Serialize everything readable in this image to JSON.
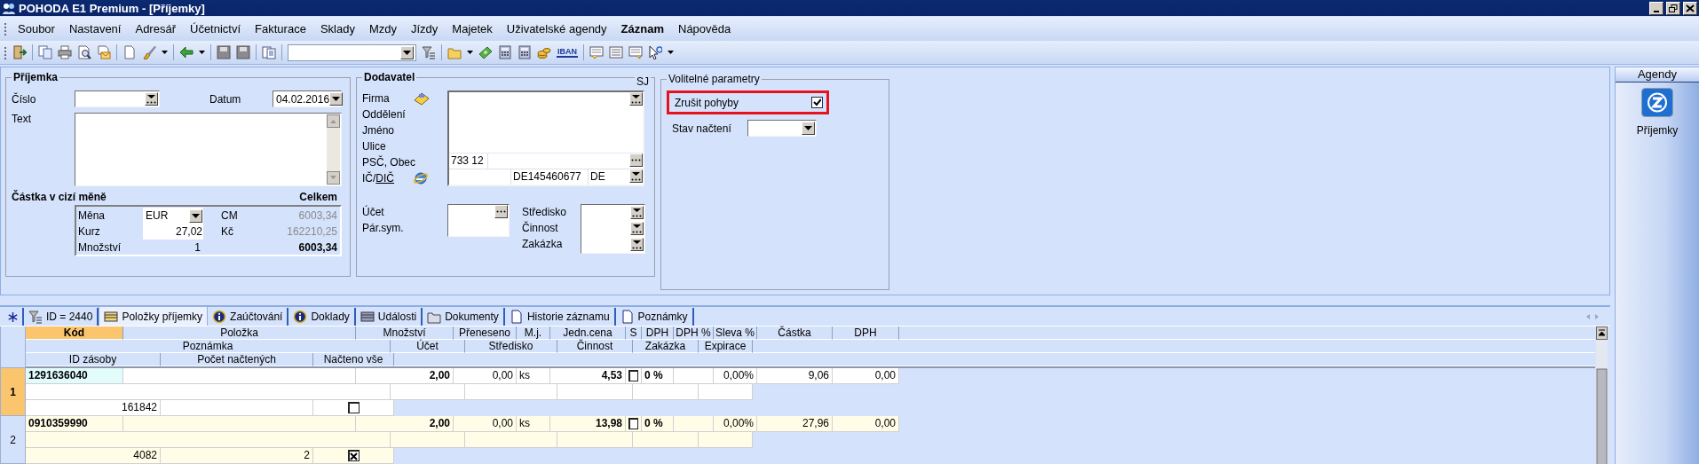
{
  "window": {
    "title": "POHODA E1 Premium - [Příjemky]"
  },
  "menu": [
    {
      "label": "Soubor",
      "bold": false
    },
    {
      "label": "Nastavení",
      "bold": false
    },
    {
      "label": "Adresář",
      "bold": false
    },
    {
      "label": "Účetnictví",
      "bold": false
    },
    {
      "label": "Fakturace",
      "bold": false
    },
    {
      "label": "Sklady",
      "bold": false
    },
    {
      "label": "Mzdy",
      "bold": false
    },
    {
      "label": "Jízdy",
      "bold": false
    },
    {
      "label": "Majetek",
      "bold": false
    },
    {
      "label": "Uživatelské agendy",
      "bold": false
    },
    {
      "label": "Záznam",
      "bold": true
    },
    {
      "label": "Nápověda",
      "bold": false
    }
  ],
  "toolbar": {
    "iban_label": "IBAN"
  },
  "receipt": {
    "title": "Příjemka",
    "number_label": "Číslo",
    "date_label": "Datum",
    "date_value": "04.02.2016",
    "text_label": "Text",
    "foreign": {
      "title": "Částka v cizí měně",
      "total_heading": "Celkem",
      "lines": [
        {
          "label": "Měna",
          "value": "EUR",
          "kind": "dropdown",
          "total_label": "CM",
          "total": "6003,34",
          "total_dimmed": true,
          "total_bold": false
        },
        {
          "label": "Kurz",
          "value": "27,02",
          "kind": "input",
          "total_label": "Kč",
          "total": "162210,25",
          "total_dimmed": true,
          "total_bold": false
        },
        {
          "label": "Množství",
          "value": "1",
          "kind": "plain",
          "total": "6003,34",
          "total_dimmed": false,
          "total_bold": true
        }
      ]
    }
  },
  "supplier": {
    "title": "Dodavatel",
    "corner": "SJ",
    "labels": [
      "Firma",
      "Oddělení",
      "Jméno",
      "Ulice",
      "PSČ, Obec"
    ],
    "ic_label": "IČ/",
    "dic_link": "DIČ",
    "psc": "733 12",
    "dic": "DE145460677",
    "country": "DE",
    "account_label": "Účet",
    "symbol_label": "Pár.sym.",
    "centre_labels": [
      "Středisko",
      "Činnost",
      "Zakázka"
    ]
  },
  "options": {
    "title": "Volitelné parametry",
    "cancel_moves": {
      "label": "Zrušit pohyby",
      "checked": true,
      "highlighted": true
    },
    "load_state": {
      "label": "Stav načtení"
    }
  },
  "agenda": {
    "title": "Agendy",
    "items": [
      {
        "label": "Příjemky"
      }
    ]
  },
  "tabs": [
    {
      "label": "ID = 2440",
      "kind": "filter",
      "selected": false
    },
    {
      "label": "Položky příjemky",
      "kind": "list",
      "selected": true
    },
    {
      "label": "Zaúčtování",
      "kind": "info",
      "selected": false
    },
    {
      "label": "Doklady",
      "kind": "info",
      "selected": false
    },
    {
      "label": "Události",
      "kind": "table",
      "selected": false
    },
    {
      "label": "Dokumenty",
      "kind": "folder",
      "selected": false
    },
    {
      "label": "Historie záznamu",
      "kind": "page",
      "selected": false
    },
    {
      "label": "Poznámky",
      "kind": "page",
      "selected": false
    }
  ],
  "grid": {
    "columns_line1": [
      {
        "label": "Kód",
        "selected": true
      },
      {
        "label": "Položka",
        "selected": false
      },
      {
        "label": "Množství",
        "selected": false
      },
      {
        "label": "Přeneseno",
        "selected": false
      },
      {
        "label": "M.j.",
        "selected": false
      },
      {
        "label": "Jedn.cena",
        "selected": false
      },
      {
        "label": "S",
        "selected": false
      },
      {
        "label": "DPH",
        "selected": false
      },
      {
        "label": "DPH %",
        "selected": false
      },
      {
        "label": "Sleva %",
        "selected": false
      },
      {
        "label": "Částka",
        "selected": false
      },
      {
        "label": "DPH",
        "selected": false
      }
    ],
    "columns_line2": [
      "Poznámka",
      "Účet",
      "Středisko",
      "Činnost",
      "Zakázka",
      "Expirace"
    ],
    "columns_line3": [
      "ID zásoby",
      "Počet načtených",
      "Načteno vše"
    ],
    "rows": [
      {
        "number": "1",
        "selected": true,
        "kod": "1291636040",
        "mnozstvi": "2,00",
        "preneseno": "0,00",
        "mj": "ks",
        "jedn_cena": "4,53",
        "s_checked": false,
        "dph": "0 %",
        "sleva": "0,00%",
        "castka": "9,06",
        "dph_castka": "0,00",
        "id_zasoby": "161842",
        "nacteno_vse": false
      },
      {
        "number": "2",
        "selected": false,
        "kod": "0910359990",
        "mnozstvi": "2,00",
        "preneseno": "0,00",
        "mj": "ks",
        "jedn_cena": "13,98",
        "s_checked": false,
        "dph": "0 %",
        "sleva": "0,00%",
        "castka": "27,96",
        "dph_castka": "0,00",
        "id_zasoby": "4082",
        "pocet_nactenych": "2",
        "nacteno_vse": true
      }
    ]
  }
}
